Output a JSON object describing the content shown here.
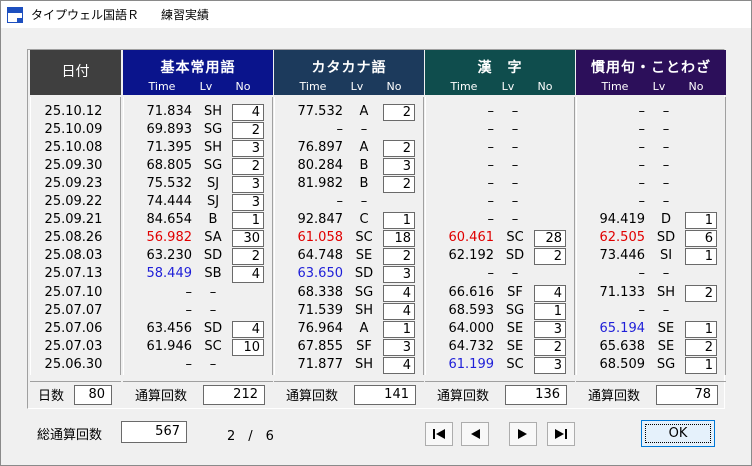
{
  "window": {
    "app_title": "タイプウェル国語Ｒ",
    "subtitle": "練習実績"
  },
  "header": {
    "date_label": "日付",
    "sub_time": "Time",
    "sub_lv": "Lv",
    "sub_no": "No"
  },
  "dates": [
    "25.10.12",
    "25.10.09",
    "25.10.08",
    "25.09.30",
    "25.09.23",
    "25.09.22",
    "25.09.21",
    "25.08.26",
    "25.08.03",
    "25.07.13",
    "25.07.10",
    "25.07.07",
    "25.07.06",
    "25.07.03",
    "25.06.30"
  ],
  "colors": {
    "head_date": "#3f3f3f",
    "head_kihon": "#0a148c",
    "head_katakana": "#1c3a5c",
    "head_kanji": "#0f4d4d",
    "head_kanyo": "#2c0f5a",
    "red": "#e00000",
    "blue": "#1f1fd8"
  },
  "categories": [
    {
      "title": "基本常用語",
      "rows": [
        {
          "time": "71.834",
          "lv": "SH",
          "no": "4",
          "c": ""
        },
        {
          "time": "69.893",
          "lv": "SG",
          "no": "2",
          "c": ""
        },
        {
          "time": "71.395",
          "lv": "SH",
          "no": "3",
          "c": ""
        },
        {
          "time": "68.805",
          "lv": "SG",
          "no": "2",
          "c": ""
        },
        {
          "time": "75.532",
          "lv": "SJ",
          "no": "3",
          "c": ""
        },
        {
          "time": "74.444",
          "lv": "SJ",
          "no": "3",
          "c": ""
        },
        {
          "time": "84.654",
          "lv": "B",
          "no": "1",
          "c": ""
        },
        {
          "time": "56.982",
          "lv": "SA",
          "no": "30",
          "c": "red"
        },
        {
          "time": "63.230",
          "lv": "SD",
          "no": "2",
          "c": ""
        },
        {
          "time": "58.449",
          "lv": "SB",
          "no": "4",
          "c": "blue"
        },
        {
          "time": "–",
          "lv": "–",
          "no": "",
          "c": ""
        },
        {
          "time": "–",
          "lv": "–",
          "no": "",
          "c": ""
        },
        {
          "time": "63.456",
          "lv": "SD",
          "no": "4",
          "c": ""
        },
        {
          "time": "61.946",
          "lv": "SC",
          "no": "10",
          "c": ""
        },
        {
          "time": "–",
          "lv": "–",
          "no": "",
          "c": ""
        }
      ],
      "total_label": "通算回数",
      "total": "212"
    },
    {
      "title": "カタカナ語",
      "rows": [
        {
          "time": "77.532",
          "lv": "A",
          "no": "2",
          "c": ""
        },
        {
          "time": "–",
          "lv": "–",
          "no": "",
          "c": ""
        },
        {
          "time": "76.897",
          "lv": "A",
          "no": "2",
          "c": ""
        },
        {
          "time": "80.284",
          "lv": "B",
          "no": "3",
          "c": ""
        },
        {
          "time": "81.982",
          "lv": "B",
          "no": "2",
          "c": ""
        },
        {
          "time": "–",
          "lv": "–",
          "no": "",
          "c": ""
        },
        {
          "time": "92.847",
          "lv": "C",
          "no": "1",
          "c": ""
        },
        {
          "time": "61.058",
          "lv": "SC",
          "no": "18",
          "c": "red"
        },
        {
          "time": "64.748",
          "lv": "SE",
          "no": "2",
          "c": ""
        },
        {
          "time": "63.650",
          "lv": "SD",
          "no": "3",
          "c": "blue"
        },
        {
          "time": "68.338",
          "lv": "SG",
          "no": "4",
          "c": ""
        },
        {
          "time": "71.539",
          "lv": "SH",
          "no": "4",
          "c": ""
        },
        {
          "time": "76.964",
          "lv": "A",
          "no": "1",
          "c": ""
        },
        {
          "time": "67.855",
          "lv": "SF",
          "no": "3",
          "c": ""
        },
        {
          "time": "71.877",
          "lv": "SH",
          "no": "4",
          "c": ""
        }
      ],
      "total_label": "通算回数",
      "total": "141"
    },
    {
      "title": "漢　字",
      "rows": [
        {
          "time": "–",
          "lv": "–",
          "no": "",
          "c": ""
        },
        {
          "time": "–",
          "lv": "–",
          "no": "",
          "c": ""
        },
        {
          "time": "–",
          "lv": "–",
          "no": "",
          "c": ""
        },
        {
          "time": "–",
          "lv": "–",
          "no": "",
          "c": ""
        },
        {
          "time": "–",
          "lv": "–",
          "no": "",
          "c": ""
        },
        {
          "time": "–",
          "lv": "–",
          "no": "",
          "c": ""
        },
        {
          "time": "–",
          "lv": "–",
          "no": "",
          "c": ""
        },
        {
          "time": "60.461",
          "lv": "SC",
          "no": "28",
          "c": "red"
        },
        {
          "time": "62.192",
          "lv": "SD",
          "no": "2",
          "c": ""
        },
        {
          "time": "–",
          "lv": "–",
          "no": "",
          "c": ""
        },
        {
          "time": "66.616",
          "lv": "SF",
          "no": "4",
          "c": ""
        },
        {
          "time": "68.593",
          "lv": "SG",
          "no": "1",
          "c": ""
        },
        {
          "time": "64.000",
          "lv": "SE",
          "no": "3",
          "c": ""
        },
        {
          "time": "64.732",
          "lv": "SE",
          "no": "2",
          "c": ""
        },
        {
          "time": "61.199",
          "lv": "SC",
          "no": "3",
          "c": "blue"
        }
      ],
      "total_label": "通算回数",
      "total": "136"
    },
    {
      "title": "慣用句・ことわざ",
      "rows": [
        {
          "time": "–",
          "lv": "–",
          "no": "",
          "c": ""
        },
        {
          "time": "–",
          "lv": "–",
          "no": "",
          "c": ""
        },
        {
          "time": "–",
          "lv": "–",
          "no": "",
          "c": ""
        },
        {
          "time": "–",
          "lv": "–",
          "no": "",
          "c": ""
        },
        {
          "time": "–",
          "lv": "–",
          "no": "",
          "c": ""
        },
        {
          "time": "–",
          "lv": "–",
          "no": "",
          "c": ""
        },
        {
          "time": "94.419",
          "lv": "D",
          "no": "1",
          "c": ""
        },
        {
          "time": "62.505",
          "lv": "SD",
          "no": "6",
          "c": "red"
        },
        {
          "time": "73.446",
          "lv": "SI",
          "no": "1",
          "c": ""
        },
        {
          "time": "–",
          "lv": "–",
          "no": "",
          "c": ""
        },
        {
          "time": "71.133",
          "lv": "SH",
          "no": "2",
          "c": ""
        },
        {
          "time": "–",
          "lv": "–",
          "no": "",
          "c": ""
        },
        {
          "time": "65.194",
          "lv": "SE",
          "no": "1",
          "c": "blue"
        },
        {
          "time": "65.638",
          "lv": "SE",
          "no": "2",
          "c": ""
        },
        {
          "time": "68.509",
          "lv": "SG",
          "no": "1",
          "c": ""
        }
      ],
      "total_label": "通算回数",
      "total": "78"
    }
  ],
  "footer": {
    "days_label": "日数",
    "days_value": "80",
    "grand_label": "総通算回数",
    "grand_value": "567",
    "page_indicator": "2　/　6",
    "ok_label": "OK"
  },
  "nav": {
    "first": "first-page-icon",
    "prev": "previous-page-icon",
    "next": "next-page-icon",
    "last": "last-page-icon"
  }
}
